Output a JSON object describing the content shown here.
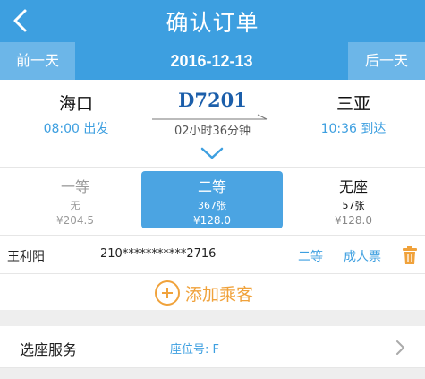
{
  "header": {
    "title": "确认订单",
    "back_icon": "chevron-left-icon"
  },
  "datebar": {
    "prev_label": "前一天",
    "date": "2016-12-13",
    "next_label": "后一天"
  },
  "train": {
    "departure": {
      "station": "海口",
      "time_label": "08:00 出发"
    },
    "number": "D7201",
    "duration": "02小时36分钟",
    "arrival": {
      "station": "三亚",
      "time_label": "10:36 到达"
    }
  },
  "seats": [
    {
      "class": "一等",
      "availability": "无",
      "price": "¥204.5",
      "selected": false
    },
    {
      "class": "二等",
      "availability": "367张",
      "price": "¥128.0",
      "selected": true
    },
    {
      "class": "无座",
      "availability": "57张",
      "price": "¥128.0",
      "selected": false
    }
  ],
  "passenger": {
    "name": "王利阳",
    "id_number": "210***********2716",
    "seat_class": "二等",
    "ticket_type": "成人票"
  },
  "add_passenger": {
    "label": "添加乘客"
  },
  "seat_service": {
    "label": "选座服务",
    "value": "座位号: F"
  },
  "colors": {
    "primary": "#3d9fe0",
    "accent": "#f0a23b",
    "train_number": "#1b5eaa"
  }
}
